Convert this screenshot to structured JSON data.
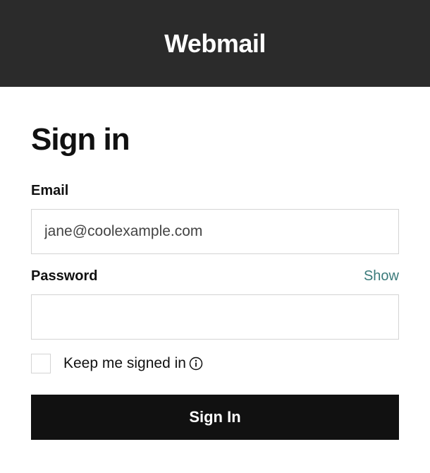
{
  "header": {
    "title": "Webmail"
  },
  "page": {
    "title": "Sign in"
  },
  "form": {
    "email_label": "Email",
    "email_value": "jane@coolexample.com",
    "password_label": "Password",
    "password_value": "",
    "show_label": "Show",
    "keep_signed_label": "Keep me signed in",
    "signin_button_label": "Sign In"
  }
}
